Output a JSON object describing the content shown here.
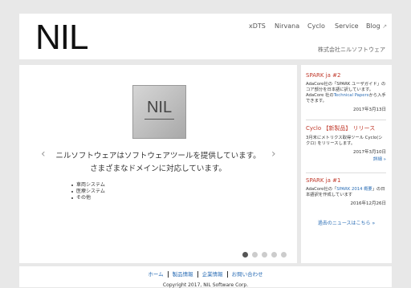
{
  "header": {
    "logo": "NIL",
    "nav": [
      "xDTS",
      "Nirvana",
      "Cyclo",
      "Service",
      "Blog"
    ],
    "company": "株式会社ニルソフトウェア"
  },
  "slide": {
    "logo_text": "NIL",
    "line1": "ニルソフトウェアはソフトウェアツールを提供しています。",
    "line2": "さまざまなドメインに対応しています。",
    "items": [
      "車両システム",
      "医療システム",
      "その他"
    ],
    "prev": "‹",
    "next": "›"
  },
  "news": [
    {
      "title": "SPARK ja #2",
      "body_pre": "AdaCore社の「SPARK ユーザガイド」のコア部分を日本語に訳しています。AdaCore 社の",
      "link": "Technical Papers",
      "body_post": "から入手できます。",
      "date": "2017年3月13日"
    },
    {
      "title": "Cyclo 【新製品】 リリース",
      "body": "3月末にメトリクス取得ツール Cyclo(シクロ) をリリースします。",
      "date": "2017年3月10日",
      "more": "詳細 »"
    },
    {
      "title": "SPARK ja #1",
      "body_pre": "AdaCore社の「",
      "link": "SPARK 2014 概要",
      "body_post": "」の日本語訳を作成しています",
      "date": "2016年12月26日"
    }
  ],
  "all_news": "過去のニュースはこちら »",
  "footer": {
    "links": [
      "ホーム",
      "製品情報",
      "企業情報",
      "お問い合わせ"
    ],
    "copyright": "Copyright 2017, NIL Software Corp."
  }
}
